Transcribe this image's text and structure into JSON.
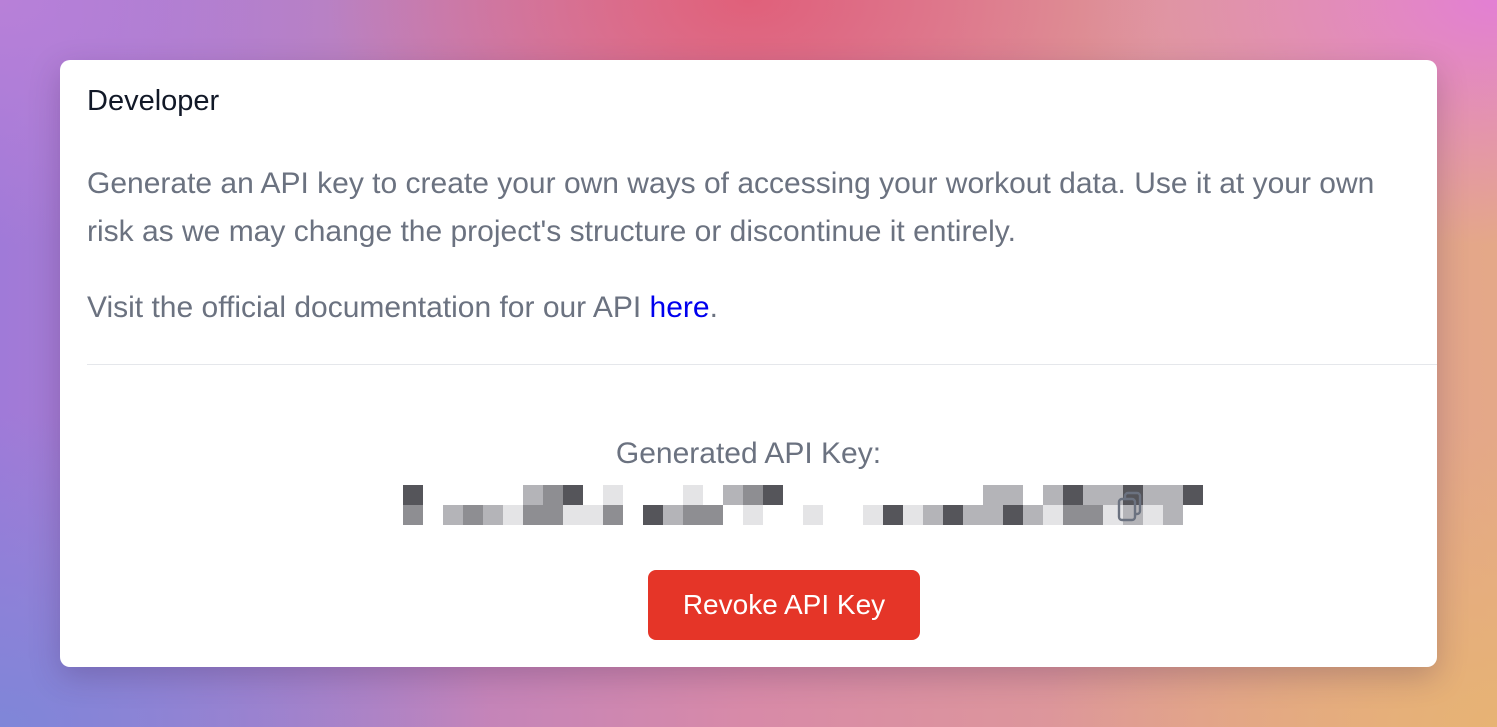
{
  "card": {
    "title": "Developer",
    "description": "Generate an API key to create your own ways of accessing your workout data. Use it at your own risk as we may change the project's structure or discontinue it entirely.",
    "docs_prefix": "Visit the official documentation for our API ",
    "docs_link_label": "here",
    "docs_suffix": "."
  },
  "api_key": {
    "label": "Generated API Key:",
    "value_redacted": true,
    "copy_icon": "copy-icon"
  },
  "actions": {
    "revoke_label": "Revoke API Key"
  },
  "colors": {
    "revoke_button": "#e53528",
    "link": "#0000ee",
    "muted_text": "#6b7280",
    "title_text": "#111827"
  }
}
